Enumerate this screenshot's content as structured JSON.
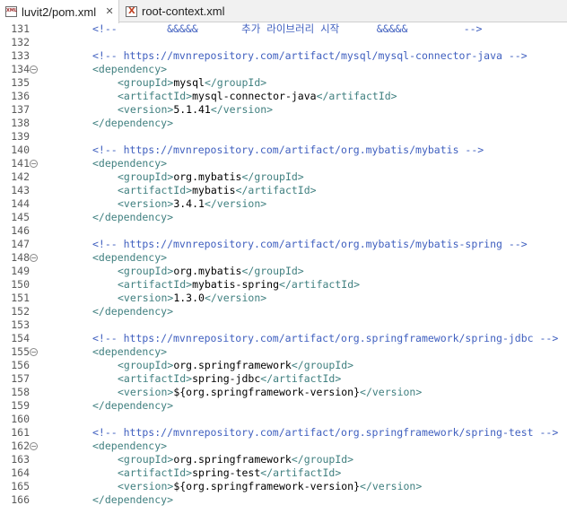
{
  "tabs": [
    {
      "label": "luvit2/pom.xml",
      "icon": "xml-file-icon",
      "active": true
    },
    {
      "label": "root-context.xml",
      "icon": "xml-file-icon",
      "active": false
    }
  ],
  "colors": {
    "comment": "#3f5fbf",
    "tag": "#3f7f7f",
    "text": "#000000",
    "line_number": "#5a5a5a"
  },
  "lines": [
    {
      "n": "131",
      "fold": false,
      "indent": 2,
      "parts": [
        {
          "t": "c",
          "v": "<!--        &&&&&       추가 라이브러리 시작      &&&&&         -->"
        }
      ]
    },
    {
      "n": "132",
      "fold": false,
      "indent": 0,
      "parts": []
    },
    {
      "n": "133",
      "fold": false,
      "indent": 2,
      "parts": [
        {
          "t": "c",
          "v": "<!-- https://mvnrepository.com/artifact/mysql/mysql-connector-java -->"
        }
      ]
    },
    {
      "n": "134",
      "fold": true,
      "indent": 2,
      "parts": [
        {
          "t": "g",
          "v": "<dependency>"
        }
      ]
    },
    {
      "n": "135",
      "fold": false,
      "indent": 3,
      "parts": [
        {
          "t": "g",
          "v": "<groupId>"
        },
        {
          "t": "x",
          "v": "mysql"
        },
        {
          "t": "g",
          "v": "</groupId>"
        }
      ]
    },
    {
      "n": "136",
      "fold": false,
      "indent": 3,
      "parts": [
        {
          "t": "g",
          "v": "<artifactId>"
        },
        {
          "t": "x",
          "v": "mysql-connector-java"
        },
        {
          "t": "g",
          "v": "</artifactId>"
        }
      ]
    },
    {
      "n": "137",
      "fold": false,
      "indent": 3,
      "parts": [
        {
          "t": "g",
          "v": "<version>"
        },
        {
          "t": "x",
          "v": "5.1.41"
        },
        {
          "t": "g",
          "v": "</version>"
        }
      ]
    },
    {
      "n": "138",
      "fold": false,
      "indent": 2,
      "parts": [
        {
          "t": "g",
          "v": "</dependency>"
        }
      ]
    },
    {
      "n": "139",
      "fold": false,
      "indent": 0,
      "parts": []
    },
    {
      "n": "140",
      "fold": false,
      "indent": 2,
      "parts": [
        {
          "t": "c",
          "v": "<!-- https://mvnrepository.com/artifact/org.mybatis/mybatis -->"
        }
      ]
    },
    {
      "n": "141",
      "fold": true,
      "indent": 2,
      "parts": [
        {
          "t": "g",
          "v": "<dependency>"
        }
      ]
    },
    {
      "n": "142",
      "fold": false,
      "indent": 3,
      "parts": [
        {
          "t": "g",
          "v": "<groupId>"
        },
        {
          "t": "x",
          "v": "org.mybatis"
        },
        {
          "t": "g",
          "v": "</groupId>"
        }
      ]
    },
    {
      "n": "143",
      "fold": false,
      "indent": 3,
      "parts": [
        {
          "t": "g",
          "v": "<artifactId>"
        },
        {
          "t": "x",
          "v": "mybatis"
        },
        {
          "t": "g",
          "v": "</artifactId>"
        }
      ]
    },
    {
      "n": "144",
      "fold": false,
      "indent": 3,
      "parts": [
        {
          "t": "g",
          "v": "<version>"
        },
        {
          "t": "x",
          "v": "3.4.1"
        },
        {
          "t": "g",
          "v": "</version>"
        }
      ]
    },
    {
      "n": "145",
      "fold": false,
      "indent": 2,
      "parts": [
        {
          "t": "g",
          "v": "</dependency>"
        }
      ]
    },
    {
      "n": "146",
      "fold": false,
      "indent": 0,
      "parts": []
    },
    {
      "n": "147",
      "fold": false,
      "indent": 2,
      "parts": [
        {
          "t": "c",
          "v": "<!-- https://mvnrepository.com/artifact/org.mybatis/mybatis-spring -->"
        }
      ]
    },
    {
      "n": "148",
      "fold": true,
      "indent": 2,
      "parts": [
        {
          "t": "g",
          "v": "<dependency>"
        }
      ]
    },
    {
      "n": "149",
      "fold": false,
      "indent": 3,
      "parts": [
        {
          "t": "g",
          "v": "<groupId>"
        },
        {
          "t": "x",
          "v": "org.mybatis"
        },
        {
          "t": "g",
          "v": "</groupId>"
        }
      ]
    },
    {
      "n": "150",
      "fold": false,
      "indent": 3,
      "parts": [
        {
          "t": "g",
          "v": "<artifactId>"
        },
        {
          "t": "x",
          "v": "mybatis-spring"
        },
        {
          "t": "g",
          "v": "</artifactId>"
        }
      ]
    },
    {
      "n": "151",
      "fold": false,
      "indent": 3,
      "parts": [
        {
          "t": "g",
          "v": "<version>"
        },
        {
          "t": "x",
          "v": "1.3.0"
        },
        {
          "t": "g",
          "v": "</version>"
        }
      ]
    },
    {
      "n": "152",
      "fold": false,
      "indent": 2,
      "parts": [
        {
          "t": "g",
          "v": "</dependency>"
        }
      ]
    },
    {
      "n": "153",
      "fold": false,
      "indent": 0,
      "parts": []
    },
    {
      "n": "154",
      "fold": false,
      "indent": 2,
      "parts": [
        {
          "t": "c",
          "v": "<!-- https://mvnrepository.com/artifact/org.springframework/spring-jdbc -->"
        }
      ]
    },
    {
      "n": "155",
      "fold": true,
      "indent": 2,
      "parts": [
        {
          "t": "g",
          "v": "<dependency>"
        }
      ]
    },
    {
      "n": "156",
      "fold": false,
      "indent": 3,
      "parts": [
        {
          "t": "g",
          "v": "<groupId>"
        },
        {
          "t": "x",
          "v": "org.springframework"
        },
        {
          "t": "g",
          "v": "</groupId>"
        }
      ]
    },
    {
      "n": "157",
      "fold": false,
      "indent": 3,
      "parts": [
        {
          "t": "g",
          "v": "<artifactId>"
        },
        {
          "t": "x",
          "v": "spring-jdbc"
        },
        {
          "t": "g",
          "v": "</artifactId>"
        }
      ]
    },
    {
      "n": "158",
      "fold": false,
      "indent": 3,
      "parts": [
        {
          "t": "g",
          "v": "<version>"
        },
        {
          "t": "x",
          "v": "${org.springframework-version}"
        },
        {
          "t": "g",
          "v": "</version>"
        }
      ]
    },
    {
      "n": "159",
      "fold": false,
      "indent": 2,
      "parts": [
        {
          "t": "g",
          "v": "</dependency>"
        }
      ]
    },
    {
      "n": "160",
      "fold": false,
      "indent": 0,
      "parts": []
    },
    {
      "n": "161",
      "fold": false,
      "indent": 2,
      "parts": [
        {
          "t": "c",
          "v": "<!-- https://mvnrepository.com/artifact/org.springframework/spring-test -->"
        }
      ]
    },
    {
      "n": "162",
      "fold": true,
      "indent": 2,
      "parts": [
        {
          "t": "g",
          "v": "<dependency>"
        }
      ]
    },
    {
      "n": "163",
      "fold": false,
      "indent": 3,
      "parts": [
        {
          "t": "g",
          "v": "<groupId>"
        },
        {
          "t": "x",
          "v": "org.springframework"
        },
        {
          "t": "g",
          "v": "</groupId>"
        }
      ]
    },
    {
      "n": "164",
      "fold": false,
      "indent": 3,
      "parts": [
        {
          "t": "g",
          "v": "<artifactId>"
        },
        {
          "t": "x",
          "v": "spring-test"
        },
        {
          "t": "g",
          "v": "</artifactId>"
        }
      ]
    },
    {
      "n": "165",
      "fold": false,
      "indent": 3,
      "parts": [
        {
          "t": "g",
          "v": "<version>"
        },
        {
          "t": "x",
          "v": "${org.springframework-version}"
        },
        {
          "t": "g",
          "v": "</version>"
        }
      ]
    },
    {
      "n": "166",
      "fold": false,
      "indent": 2,
      "parts": [
        {
          "t": "g",
          "v": "</dependency>"
        }
      ]
    }
  ]
}
